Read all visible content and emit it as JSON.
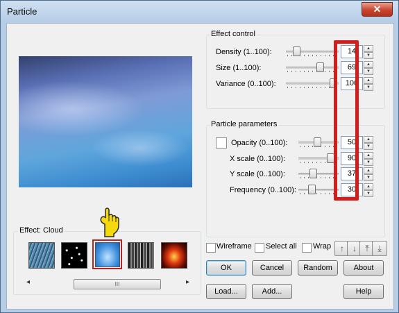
{
  "window": {
    "title": "Particle",
    "close_glyph": "✕"
  },
  "effect_control": {
    "legend": "Effect control",
    "rows": [
      {
        "label": "Density (1..100):",
        "value": "14"
      },
      {
        "label": "Size (1..100):",
        "value": "69"
      },
      {
        "label": "Variance (0..100):",
        "value": "100"
      }
    ]
  },
  "particle_params": {
    "legend": "Particle parameters",
    "rows": [
      {
        "label": "Opacity (0..100):",
        "value": "50"
      },
      {
        "label": "X scale (0..100):",
        "value": "90"
      },
      {
        "label": "Y scale (0..100):",
        "value": "37"
      },
      {
        "label": "Frequency (0..100):",
        "value": "30"
      }
    ]
  },
  "effect_group": {
    "legend": "Effect: Cloud"
  },
  "thumbnails": [
    {
      "name": "rain-thumbnail",
      "selected": false
    },
    {
      "name": "stars-thumbnail",
      "selected": false
    },
    {
      "name": "cloud-thumbnail",
      "selected": true
    },
    {
      "name": "smoke-thumbnail",
      "selected": false
    },
    {
      "name": "fire-thumbnail",
      "selected": false
    }
  ],
  "scrollbar": {
    "left_glyph": "◂",
    "right_glyph": "▸",
    "grip": "III"
  },
  "options": {
    "wireframe": "Wireframe",
    "select_all": "Select all",
    "wrap": "Wrap"
  },
  "order_arrows": [
    "↑",
    "↓",
    "⤒",
    "⤓"
  ],
  "buttons": {
    "ok": "OK",
    "cancel": "Cancel",
    "random": "Random",
    "about": "About",
    "load": "Load...",
    "add": "Add...",
    "help": "Help"
  },
  "colors": {
    "highlight_red": "#d21d1d",
    "pointer_yellow": "#f5d90f"
  }
}
